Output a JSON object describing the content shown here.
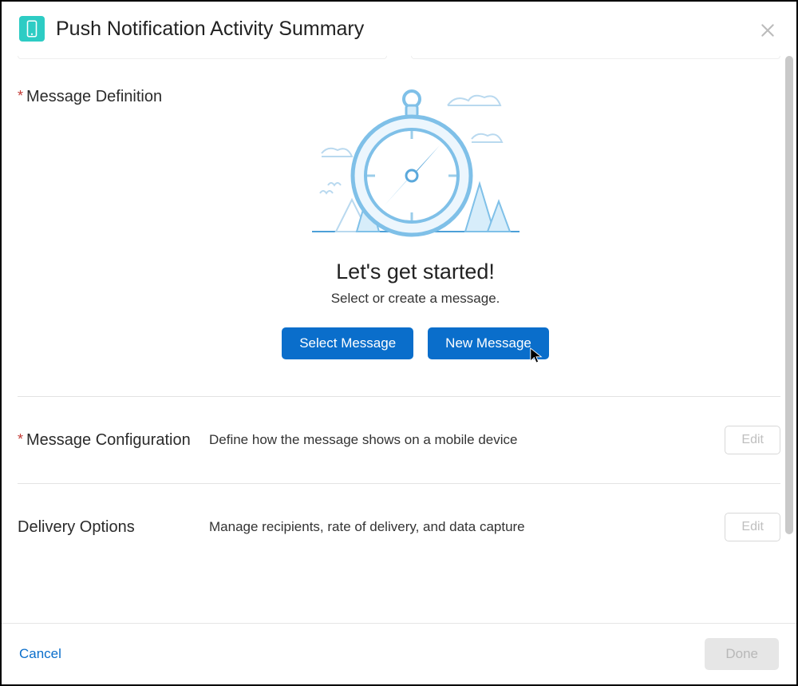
{
  "header": {
    "title": "Push Notification Activity Summary"
  },
  "sections": {
    "messageDefinition": {
      "label": "Message Definition",
      "heading": "Let's get started!",
      "subtext": "Select or create a message.",
      "selectBtn": "Select Message",
      "newBtn": "New Message"
    },
    "messageConfiguration": {
      "label": "Message Configuration",
      "desc": "Define how the message shows on a mobile device",
      "editBtn": "Edit"
    },
    "deliveryOptions": {
      "label": "Delivery Options",
      "desc": "Manage recipients, rate of delivery, and data capture",
      "editBtn": "Edit"
    }
  },
  "footer": {
    "cancel": "Cancel",
    "done": "Done"
  }
}
